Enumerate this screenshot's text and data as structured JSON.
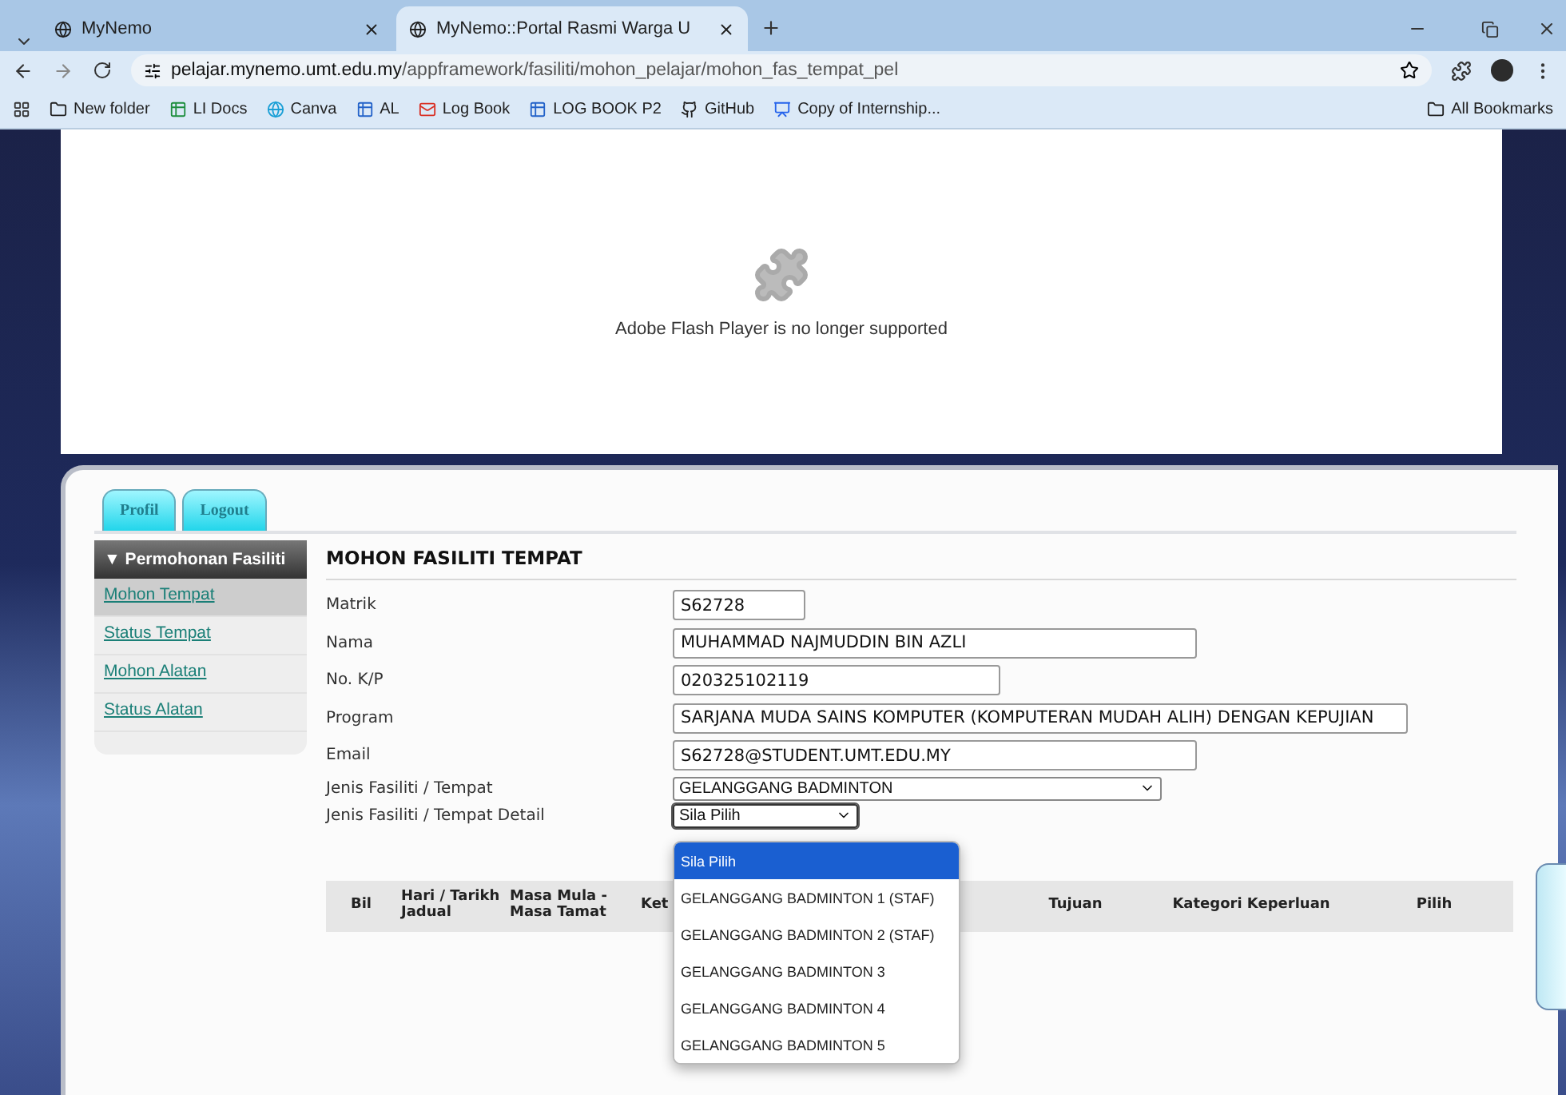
{
  "browser": {
    "tabs": [
      {
        "title": "MyNemo",
        "selected": false
      },
      {
        "title": "MyNemo::Portal Rasmi Warga U",
        "selected": true
      }
    ],
    "url": {
      "host": "pelajar.mynemo.umt.edu.my",
      "path": "/appframework/fasiliti/mohon_pelajar/mohon_fas_tempat_pel"
    },
    "bookmarks": [
      {
        "label": "New folder",
        "kind": "folder"
      },
      {
        "label": "LI Docs",
        "kind": "docs"
      },
      {
        "label": "Canva",
        "kind": "canva"
      },
      {
        "label": "AL",
        "kind": "sheet"
      },
      {
        "label": "Log Book",
        "kind": "mail"
      },
      {
        "label": "LOG BOOK P2",
        "kind": "sheet"
      },
      {
        "label": "GitHub",
        "kind": "github"
      },
      {
        "label": "Copy of Internship...",
        "kind": "slides"
      }
    ],
    "all_bookmarks": "All Bookmarks"
  },
  "flash": {
    "message": "Adobe Flash Player is no longer supported"
  },
  "top_tabs": [
    {
      "label": "Profil"
    },
    {
      "label": "Logout"
    }
  ],
  "sidebar": {
    "title": "▼ Permohonan Fasiliti",
    "items": [
      {
        "label": "Mohon Tempat",
        "selected": true
      },
      {
        "label": "Status Tempat",
        "selected": false
      },
      {
        "label": "Mohon Alatan",
        "selected": false
      },
      {
        "label": "Status Alatan",
        "selected": false
      }
    ]
  },
  "form": {
    "title": "MOHON FASILITI TEMPAT",
    "fields": [
      {
        "label": "Matrik",
        "kind": "text",
        "value": "S62728"
      },
      {
        "label": "Nama",
        "kind": "text",
        "value": "MUHAMMAD NAJMUDDIN BIN AZLI"
      },
      {
        "label": "No. K/P",
        "kind": "text",
        "value": "020325102119"
      },
      {
        "label": "Program",
        "kind": "text",
        "value": "SARJANA MUDA SAINS KOMPUTER (KOMPUTERAN MUDAH ALIH) DENGAN KEPUJIAN"
      },
      {
        "label": "Email",
        "kind": "text",
        "value": "S62728@STUDENT.UMT.EDU.MY"
      },
      {
        "label": "Jenis Fasiliti / Tempat",
        "kind": "select",
        "value": "GELANGGANG BADMINTON",
        "open": false
      },
      {
        "label": "Jenis Fasiliti / Tempat Detail",
        "kind": "select",
        "value": "Sila Pilih",
        "open": true
      }
    ]
  },
  "dropdown": {
    "options": [
      {
        "label": "Sila Pilih",
        "selected": true
      },
      {
        "label": "GELANGGANG BADMINTON 1 (STAF)",
        "selected": false
      },
      {
        "label": "GELANGGANG BADMINTON 2 (STAF)",
        "selected": false
      },
      {
        "label": "GELANGGANG BADMINTON 3",
        "selected": false
      },
      {
        "label": "GELANGGANG BADMINTON 4",
        "selected": false
      },
      {
        "label": "GELANGGANG BADMINTON 5",
        "selected": false
      }
    ]
  },
  "table": {
    "columns": [
      "Bil",
      "Hari / Tarikh Jadual",
      "Masa Mula - Masa Tamat",
      "Ket",
      "Tujuan",
      "Kategori Keperluan",
      "Pilih"
    ]
  }
}
